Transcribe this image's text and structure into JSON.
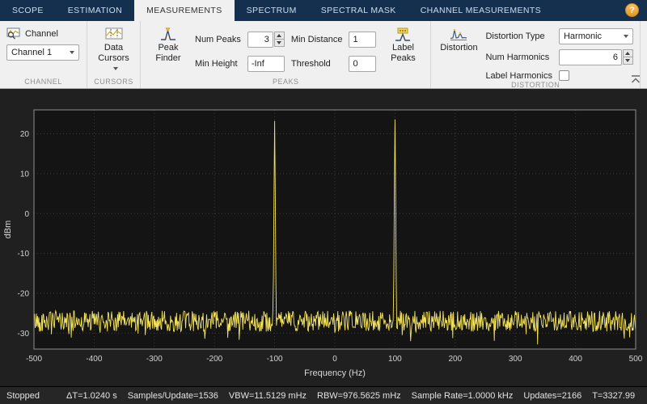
{
  "tabs": [
    {
      "label": "SCOPE",
      "active": false
    },
    {
      "label": "ESTIMATION",
      "active": false
    },
    {
      "label": "MEASUREMENTS",
      "active": true
    },
    {
      "label": "SPECTRUM",
      "active": false
    },
    {
      "label": "SPECTRAL MASK",
      "active": false
    },
    {
      "label": "CHANNEL MEASUREMENTS",
      "active": false
    }
  ],
  "help": {
    "label": "?"
  },
  "ribbon": {
    "channel": {
      "label": "Channel",
      "value": "Channel 1",
      "caption": "CHANNEL"
    },
    "cursors": {
      "button": "Data Cursors",
      "caption": "CURSORS"
    },
    "peaks": {
      "button": "Peak Finder",
      "fields": [
        {
          "label": "Num Peaks",
          "value": "3",
          "spinner": true
        },
        {
          "label": "Min Distance",
          "value": "1",
          "spinner": false
        },
        {
          "label": "Min Height",
          "value": "-Inf",
          "spinner": false
        },
        {
          "label": "Threshold",
          "value": "0",
          "spinner": false
        }
      ],
      "label_peaks": "Label Peaks",
      "caption": "PEAKS"
    },
    "distortion": {
      "button": "Distortion",
      "type_label": "Distortion Type",
      "type_value": "Harmonic",
      "num_label": "Num Harmonics",
      "num_value": "6",
      "check_label": "Label Harmonics",
      "label_harmonics_checked": false,
      "caption": "DISTORTION"
    }
  },
  "chart_data": {
    "type": "line",
    "title": "",
    "xlabel": "Frequency (Hz)",
    "ylabel": "dBm",
    "xlim": [
      -500,
      500
    ],
    "ylim": [
      -34,
      26
    ],
    "x_ticks": [
      -500,
      -400,
      -300,
      -200,
      -100,
      0,
      100,
      200,
      300,
      400,
      500
    ],
    "y_ticks": [
      -30,
      -20,
      -10,
      0,
      10,
      20
    ],
    "grid": true,
    "legend": "none",
    "line_color": "#f3e35c",
    "background": "#141414",
    "series": [
      {
        "name": "Channel 1",
        "description": "Noise floor with two sinusoid tones at -100 Hz and +100 Hz",
        "noise_floor_dbm": -27,
        "noise_amplitude_db": 2.6,
        "peaks": [
          {
            "freq_hz": -100,
            "height_dbm": 23.2
          },
          {
            "freq_hz": 100,
            "height_dbm": 23.6
          }
        ]
      }
    ]
  },
  "status_bar": {
    "state": "Stopped",
    "items": [
      "ΔT=1.0240 s",
      "Samples/Update=1536",
      "VBW=11.5129 mHz",
      "RBW=976.5625 mHz",
      "Sample Rate=1.0000 kHz",
      "Updates=2166",
      "T=3327.99"
    ]
  }
}
